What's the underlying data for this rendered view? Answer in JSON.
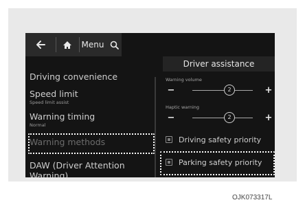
{
  "toolbar": {
    "menu_label": "Menu"
  },
  "header": {
    "title": "Driver assistance"
  },
  "sidebar": {
    "items": [
      {
        "label": "Driving convenience",
        "sub": ""
      },
      {
        "label": "Speed limit",
        "sub": "Speed limit assist"
      },
      {
        "label": "Warning timing",
        "sub": "Normal"
      },
      {
        "label": "Warning methods",
        "sub": ""
      },
      {
        "label": "DAW (Driver Attention Warning)",
        "sub": ""
      }
    ]
  },
  "settings": {
    "warning_volume": {
      "label": "Warning volume",
      "value": "2",
      "minus": "−",
      "plus": "+"
    },
    "haptic_warning": {
      "label": "Haptic warning",
      "value": "2",
      "minus": "−",
      "plus": "+"
    },
    "options": [
      {
        "label": "Driving safety priority"
      },
      {
        "label": "Parking safety priority"
      }
    ]
  },
  "caption": "OJK073317L",
  "icons": {
    "back": "back-arrow-icon",
    "home": "home-icon",
    "search": "search-icon"
  }
}
